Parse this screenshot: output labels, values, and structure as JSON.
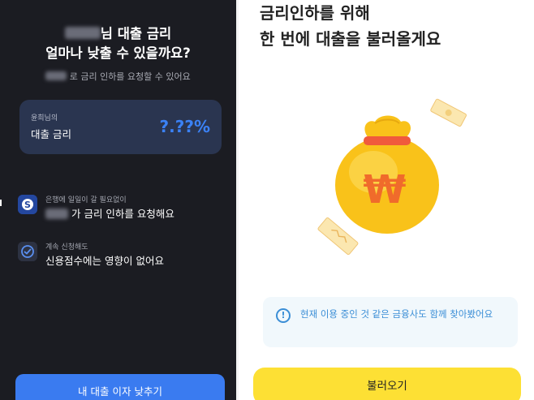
{
  "left_screen": {
    "title_line1_suffix": "님 대출 금리",
    "title_line2": "얼마나 낮출 수 있을까요?",
    "subtitle_suffix": "로 금리 인하를 요청할 수 있어요",
    "rate_card": {
      "owner": "윤희님의",
      "label": "대출 금리",
      "value": "?.??%"
    },
    "rows": [
      {
        "icon": "bank-logo-icon",
        "caption": "은행에 일일이 갈 필요없이",
        "text_suffix": "가 금리 인하를 요청해요"
      },
      {
        "icon": "gauge-icon",
        "caption": "계속 신청해도",
        "text": "신용점수에는 영향이 없어요"
      }
    ],
    "cta_label": "내 대출 이자 낮추기"
  },
  "right_screen": {
    "title_line1": "금리인하를 위해",
    "title_line2": "한 번에 대출을 불러올게요",
    "illustration": "money-bag-icon",
    "notice_icon": "info-icon",
    "notice_text": "현재 이용 중인 것 같은 금융사도 함께 찾아봤어요",
    "button_label": "불러오기"
  },
  "colors": {
    "left_background": "#1b1c22",
    "rate_card": "#2a3550",
    "rate_value": "#3b82f6",
    "cta_blue": "#3a7bf0",
    "notice_blue": "#3b8ed6",
    "button_yellow": "#fde034",
    "bag_yellow": "#f9c21a"
  }
}
